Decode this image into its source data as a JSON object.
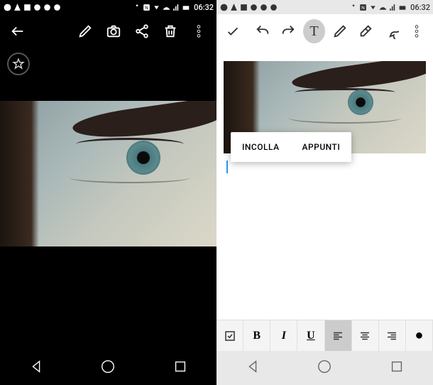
{
  "status": {
    "time": "06:32"
  },
  "left": {
    "toolbar": {
      "back": "back-icon",
      "edit": "pencil-icon",
      "camera": "camera-icon",
      "share": "share-icon",
      "delete": "trash-icon",
      "more": "more-icon"
    },
    "favorite": "star-icon"
  },
  "right": {
    "toolbar": {
      "confirm": "check-icon",
      "undo": "undo-icon",
      "redo": "redo-icon",
      "text": "T",
      "draw": "pencil-icon",
      "erase": "eraser-icon",
      "comment": "speech-icon",
      "more": "more-icon"
    },
    "context_menu": {
      "paste": "INCOLLA",
      "clipboard": "APPUNTI"
    },
    "format_bar": {
      "checkbox": "checkbox-icon",
      "bold": "B",
      "italic": "I",
      "underline": "U",
      "align_left": "align-left-icon",
      "align_center": "align-center-icon",
      "align_right": "align-right-icon",
      "bullet": "●"
    }
  },
  "navbar": {
    "back": "nav-back-icon",
    "home": "nav-home-icon",
    "recent": "nav-recent-icon"
  }
}
